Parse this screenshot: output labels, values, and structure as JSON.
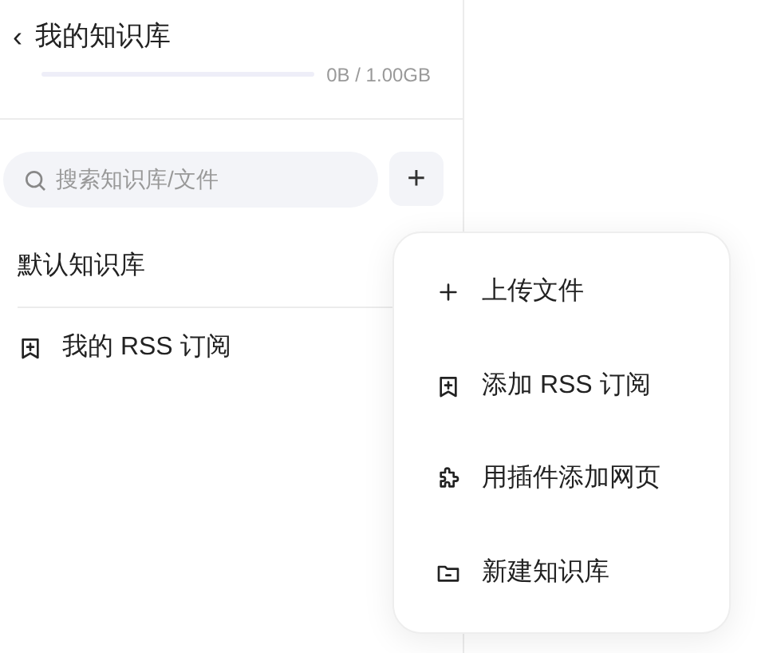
{
  "header": {
    "back": "‹",
    "title": "我的知识库",
    "storage": {
      "level": 0,
      "reading": "0B / 1.00GB"
    }
  },
  "search": {
    "placeholder": "搜索知识库/文件",
    "add_button": "+"
  },
  "sidebar": {
    "items": [
      {
        "kind": "plain",
        "label": "默认知识库"
      },
      {
        "kind": "rss",
        "label": "我的 RSS 订阅"
      }
    ]
  },
  "menu": {
    "items": [
      {
        "kind": "plus",
        "label": "上传文件"
      },
      {
        "kind": "rss",
        "label": "添加 RSS 订阅"
      },
      {
        "kind": "puzzle",
        "label": "用插件添加网页"
      },
      {
        "kind": "folder",
        "label": "新建知识库"
      }
    ]
  }
}
